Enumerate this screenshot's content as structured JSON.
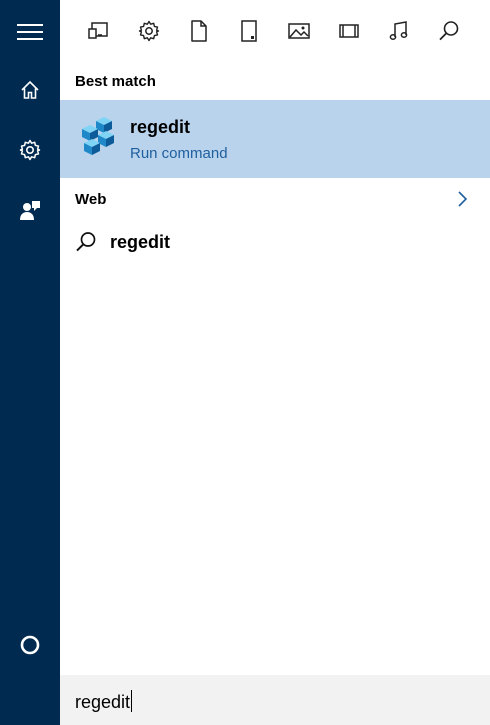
{
  "sidebar": {
    "items": [
      {
        "name": "menu",
        "icon": "hamburger-icon"
      },
      {
        "name": "home",
        "icon": "home-icon"
      },
      {
        "name": "settings",
        "icon": "gear-icon"
      },
      {
        "name": "feedback",
        "icon": "feedback-icon"
      },
      {
        "name": "cortana",
        "icon": "cortana-circle-icon"
      }
    ]
  },
  "filters": [
    {
      "name": "apps",
      "icon": "apps-icon"
    },
    {
      "name": "settings",
      "icon": "gear-icon"
    },
    {
      "name": "documents",
      "icon": "document-icon"
    },
    {
      "name": "tablet",
      "icon": "tablet-icon"
    },
    {
      "name": "photos",
      "icon": "photo-icon"
    },
    {
      "name": "videos",
      "icon": "video-icon"
    },
    {
      "name": "music",
      "icon": "music-icon"
    },
    {
      "name": "web",
      "icon": "search-icon"
    }
  ],
  "best_match": {
    "label": "Best match",
    "title": "regedit",
    "subtitle": "Run command",
    "icon": "registry-cubes-icon"
  },
  "web": {
    "label": "Web",
    "result": "regedit"
  },
  "search": {
    "query": "regedit"
  },
  "colors": {
    "rail": "#002a4f",
    "highlight": "#b9d3ec",
    "subtitle": "#1f5f9e",
    "searchbox": "#f2f2f2"
  }
}
